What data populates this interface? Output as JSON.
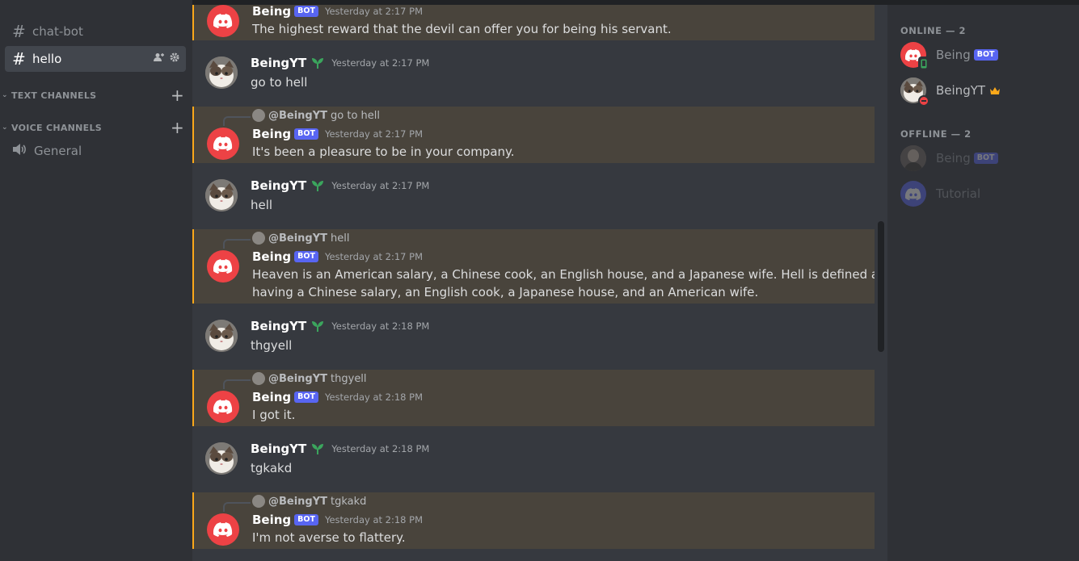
{
  "sidebar": {
    "channels": [
      {
        "label": "chat-bot"
      },
      {
        "label": "hello"
      }
    ],
    "categories": {
      "text": "TEXT CHANNELS",
      "voice": "VOICE CHANNELS"
    },
    "voice_channel": "General"
  },
  "messages": [
    {
      "author": "Being",
      "badge": "BOT",
      "time": "Yesterday at 2:17 PM",
      "text": "The highest reward that the devil can offer you for being his servant."
    },
    {
      "author": "BeingYT",
      "time": "Yesterday at 2:17 PM",
      "text": "go to hell"
    },
    {
      "reply_to": "@BeingYT",
      "reply_text": "go to hell",
      "author": "Being",
      "badge": "BOT",
      "time": "Yesterday at 2:17 PM",
      "text": "It's been a pleasure to be in your company."
    },
    {
      "author": "BeingYT",
      "time": "Yesterday at 2:17 PM",
      "text": "hell"
    },
    {
      "reply_to": "@BeingYT",
      "reply_text": "hell",
      "author": "Being",
      "badge": "BOT",
      "time": "Yesterday at 2:17 PM",
      "text_line1": "Heaven is an American salary, a Chinese cook, an English house, and a Japanese wife. Hell is defined as",
      "text_line2": "having a Chinese salary, an English cook, a Japanese house, and an American wife."
    },
    {
      "author": "BeingYT",
      "time": "Yesterday at 2:18 PM",
      "text": "thgyell"
    },
    {
      "reply_to": "@BeingYT",
      "reply_text": "thgyell",
      "author": "Being",
      "badge": "BOT",
      "time": "Yesterday at 2:18 PM",
      "text": "I got it."
    },
    {
      "author": "BeingYT",
      "time": "Yesterday at 2:18 PM",
      "text": "tgkakd"
    },
    {
      "reply_to": "@BeingYT",
      "reply_text": "tgkakd",
      "author": "Being",
      "badge": "BOT",
      "time": "Yesterday at 2:18 PM",
      "text": "I'm not averse to flattery."
    }
  ],
  "members": {
    "online_header": "ONLINE — 2",
    "offline_header": "OFFLINE — 2",
    "online": [
      {
        "name": "Being",
        "badge": "BOT"
      },
      {
        "name": "BeingYT"
      }
    ],
    "offline": [
      {
        "name": "Being",
        "badge": "BOT"
      },
      {
        "name": "Tutorial"
      }
    ]
  },
  "colors": {
    "accent": "#5865f2",
    "mention_highlight": "#faa81a",
    "bot_avatar": "#ed4245",
    "online": "#3ba55d",
    "dnd": "#ed4245",
    "owner_crown": "#faa81a"
  }
}
